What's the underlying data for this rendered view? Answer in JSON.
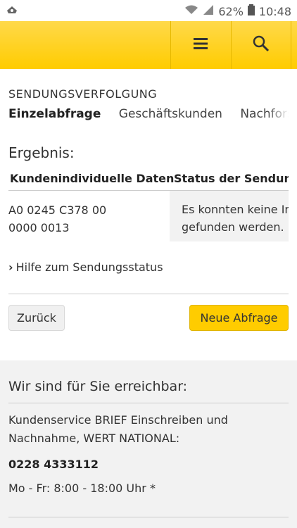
{
  "statusbar": {
    "battery": "62%",
    "time": "10:48"
  },
  "header": {
    "menu_icon": "menu-icon",
    "search_icon": "search-icon"
  },
  "page": {
    "subtitle": "SENDUNGSVERFOLGUNG",
    "tabs": [
      {
        "label": "Einzelabfrage",
        "active": true
      },
      {
        "label": "Geschäftskunden",
        "active": false
      },
      {
        "label": "Nachforsch",
        "active": false
      }
    ]
  },
  "result": {
    "title": "Ergebnis:",
    "columns": [
      "Kundenindividuelle Daten",
      "Status der Sendung"
    ],
    "row": {
      "data_line1": "A0 0245 C378 00",
      "data_line2": "0000 0013",
      "status_line1": "Es konnten keine In",
      "status_line2": "gefunden werden."
    }
  },
  "help_link": "Hilfe zum Sendungsstatus",
  "buttons": {
    "back": "Zurück",
    "new": "Neue Abfrage"
  },
  "footer": {
    "title": "Wir sind für Sie erreichbar:",
    "service_line1": "Kundenservice BRIEF Einschreiben und",
    "service_line2": "Nachnahme, WERT NATIONAL:",
    "phone": "0228 4333112",
    "hours": "Mo - Fr: 8:00 - 18:00 Uhr *"
  },
  "colors": {
    "brand_yellow": "#ffcc00",
    "footer_bg": "#f2f2f2"
  }
}
